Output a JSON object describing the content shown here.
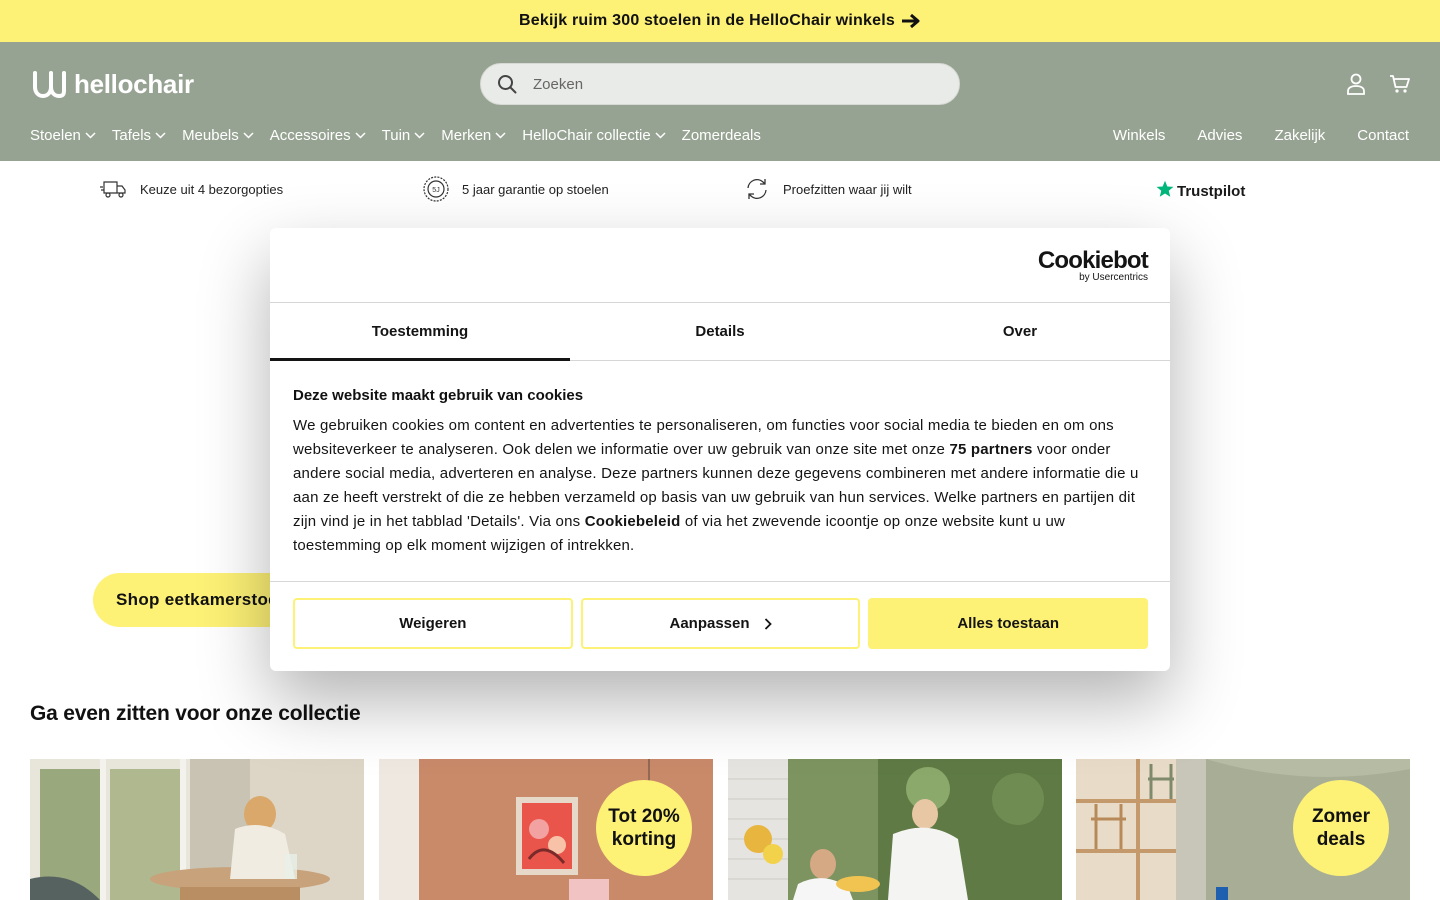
{
  "announcement": {
    "text": "Bekijk ruim 300 stoelen in de HelloChair winkels"
  },
  "header": {
    "logo_text": "hellochair",
    "search_placeholder": "Zoeken",
    "nav": [
      {
        "label": "Stoelen",
        "has_dropdown": true
      },
      {
        "label": "Tafels",
        "has_dropdown": true
      },
      {
        "label": "Meubels",
        "has_dropdown": true
      },
      {
        "label": "Accessoires",
        "has_dropdown": true
      },
      {
        "label": "Tuin",
        "has_dropdown": true
      },
      {
        "label": "Merken",
        "has_dropdown": true
      },
      {
        "label": "HelloChair collectie",
        "has_dropdown": true
      },
      {
        "label": "Zomerdeals",
        "has_dropdown": false
      }
    ],
    "nav_right": [
      "Winkels",
      "Advies",
      "Zakelijk",
      "Contact"
    ]
  },
  "usps": [
    {
      "icon": "delivery-truck-icon",
      "text": "Keuze uit 4 bezorgopties"
    },
    {
      "icon": "warranty-seal-icon",
      "text": "5 jaar garantie op stoelen"
    },
    {
      "icon": "refresh-icon",
      "text": "Proefzitten waar jij wilt"
    }
  ],
  "trustpilot": {
    "label": "Trustpilot"
  },
  "hero": {
    "button_label": "Shop eetkamerstoelen"
  },
  "collection": {
    "title": "Ga even zitten voor onze collectie",
    "cards": [
      {
        "badge": ""
      },
      {
        "badge": "Tot 20% korting"
      },
      {
        "badge": ""
      },
      {
        "badge": "Zomer deals"
      }
    ]
  },
  "cookie": {
    "brand": "Cookiebot",
    "brand_sub": "by Usercentrics",
    "tabs": [
      "Toestemming",
      "Details",
      "Over"
    ],
    "active_tab": "Toestemming",
    "title": "Deze website maakt gebruik van cookies",
    "text_1": "We gebruiken cookies om content en advertenties te personaliseren, om functies voor social media te bieden en om ons websiteverkeer te analyseren. Ook delen we informatie over uw gebruik van onze site met onze ",
    "partners": "75 partners",
    "text_2": " voor onder andere social media, adverteren en analyse. Deze partners kunnen deze gegevens combineren met andere informatie die u aan ze heeft verstrekt of die ze hebben verzameld op basis van uw gebruik van hun services. Welke partners en partijen dit zijn vind je in het tabblad 'Details'. Via ons ",
    "policy": "Cookiebeleid",
    "text_3": " of via het zwevende icoontje op onze website kunt u uw toestemming op elk moment wijzigen of intrekken.",
    "buttons": {
      "decline": "Weigeren",
      "customize": "Aanpassen",
      "accept": "Alles toestaan"
    }
  },
  "colors": {
    "accent_yellow": "#fdf176",
    "header_green": "#97a392"
  }
}
